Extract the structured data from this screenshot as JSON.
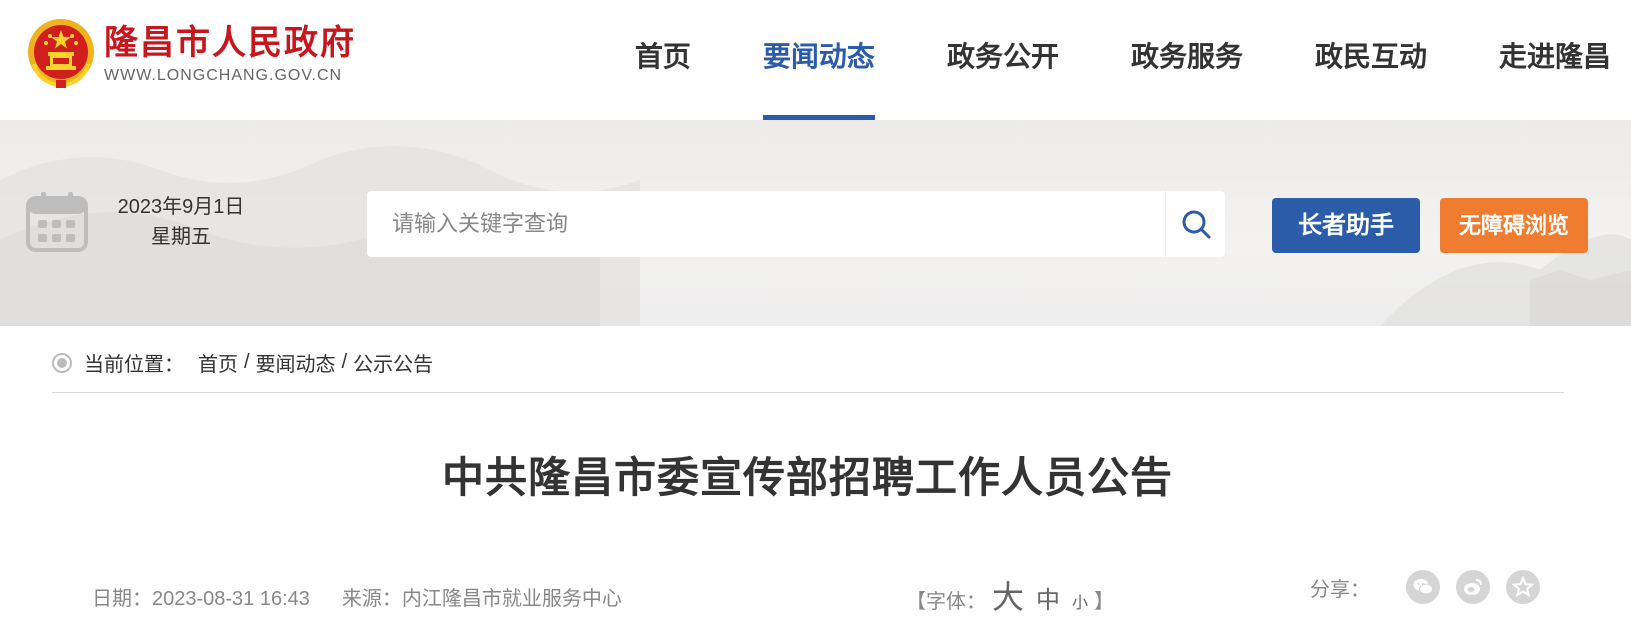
{
  "site": {
    "title": "隆昌市人民政府",
    "url": "WWW.LONGCHANG.GOV.CN"
  },
  "nav": {
    "items": [
      {
        "label": "首页"
      },
      {
        "label": "要闻动态",
        "active": true
      },
      {
        "label": "政务公开"
      },
      {
        "label": "政务服务"
      },
      {
        "label": "政民互动"
      },
      {
        "label": "走进隆昌"
      }
    ]
  },
  "banner": {
    "date": "2023年9月1日",
    "weekday": "星期五",
    "search_placeholder": "请输入关键字查询",
    "elder_button": "长者助手",
    "access_button": "无障碍浏览"
  },
  "breadcrumb": {
    "label": "当前位置：",
    "items": [
      "首页",
      "要闻动态",
      "公示公告"
    ],
    "separator": "/"
  },
  "article": {
    "title": "中共隆昌市委宣传部招聘工作人员公告",
    "date": "日期：2023-08-31 16:43",
    "source": "来源：内江隆昌市就业服务中心",
    "font_label": "【字体：",
    "font_big": "大",
    "font_mid": "中",
    "font_small": "小",
    "font_end": "】",
    "share_label": "分享："
  },
  "colors": {
    "brand_red": "#c8161d",
    "nav_active": "#2a5caa",
    "elder_button": "#2a5caa",
    "access_button": "#ef7c2f"
  },
  "icons": {
    "logo": "national-emblem-icon",
    "calendar": "calendar-icon",
    "search": "search-icon",
    "share": [
      "wechat-icon",
      "weibo-icon",
      "favorite-icon"
    ]
  }
}
